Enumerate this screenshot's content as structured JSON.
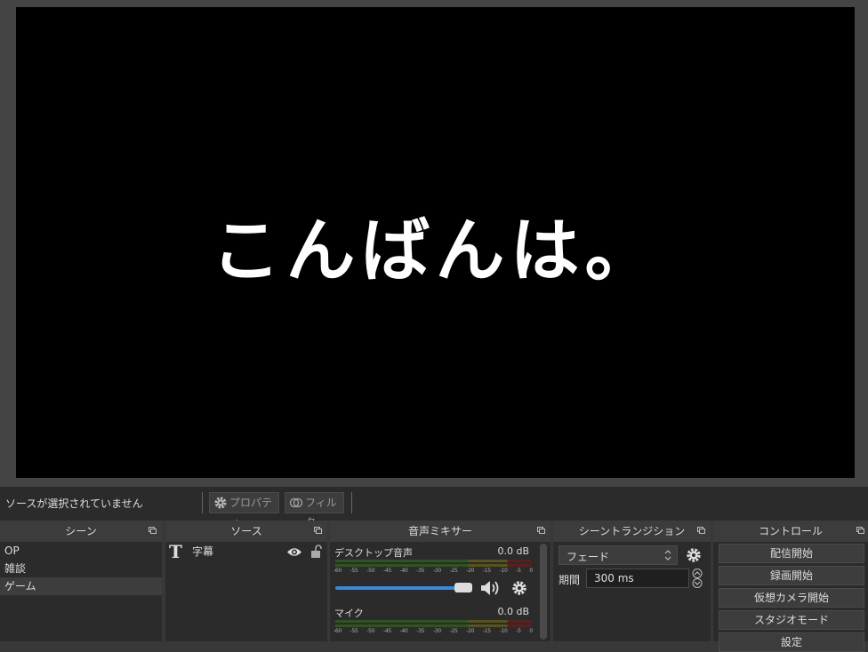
{
  "preview": {
    "text": "こんばんは。"
  },
  "context_bar": {
    "no_source_text": "ソースが選択されていません",
    "properties_label": "プロパティ",
    "filters_label": "フィルタ"
  },
  "scenes": {
    "title": "シーン",
    "items": [
      "OP",
      "雑談",
      "ゲーム"
    ],
    "selected_index": 2
  },
  "sources": {
    "title": "ソース",
    "items": [
      {
        "name": "字幕",
        "type_icon": "text-icon",
        "visible": true,
        "locked": false
      }
    ]
  },
  "mixer": {
    "title": "音声ミキサー",
    "tracks": [
      {
        "name": "デスクトップ音声",
        "level": "0.0 dB",
        "volume": 0.95,
        "muted": false
      },
      {
        "name": "マイク",
        "level": "0.0 dB"
      }
    ],
    "scale": [
      "-60",
      "-55",
      "-50",
      "-45",
      "-40",
      "-35",
      "-30",
      "-25",
      "-20",
      "-15",
      "-10",
      "-5",
      "0"
    ]
  },
  "transitions": {
    "title": "シーントランジション",
    "selected": "フェード",
    "duration_label": "期間",
    "duration_value": "300 ms"
  },
  "controls": {
    "title": "コントロール",
    "buttons": [
      "配信開始",
      "録画開始",
      "仮想カメラ開始",
      "スタジオモード",
      "設定"
    ]
  },
  "colors": {
    "meter_green": "#5a9a3a",
    "meter_yellow": "#a29a3a",
    "meter_red": "#a83838",
    "slider": "#3a88d8"
  }
}
